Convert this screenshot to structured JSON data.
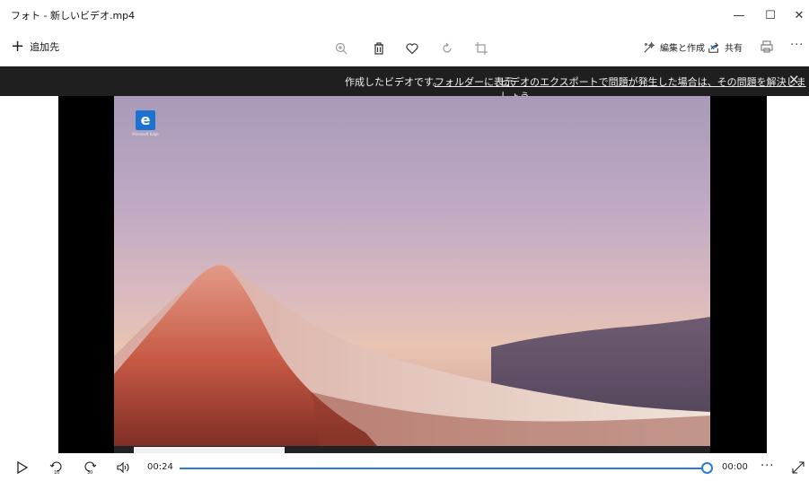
{
  "window": {
    "title": "フォト - 新しいビデオ.mp4",
    "controls": {
      "minimize": "—",
      "maximize": "☐",
      "close": "✕"
    }
  },
  "toolbar": {
    "add_label": "追加先",
    "edit_label": "編集と作成",
    "share_label": "共有",
    "more": "···"
  },
  "notification": {
    "message": "作成したビデオです。",
    "link_folder": "フォルダーに表示",
    "link_problem": "ビデオのエクスポートで問題が発生した場合は、その問題を解決しましょう。",
    "close": "✕"
  },
  "desktop": {
    "icon_label": "Microsoft Edge",
    "icon_glyph": "e"
  },
  "player": {
    "current_time": "00:24",
    "end_time": "00:00",
    "more": "···",
    "progress": 1.0,
    "accent_color": "#2b7ad6",
    "skip_back_label": "10",
    "skip_forward_label": "30"
  }
}
